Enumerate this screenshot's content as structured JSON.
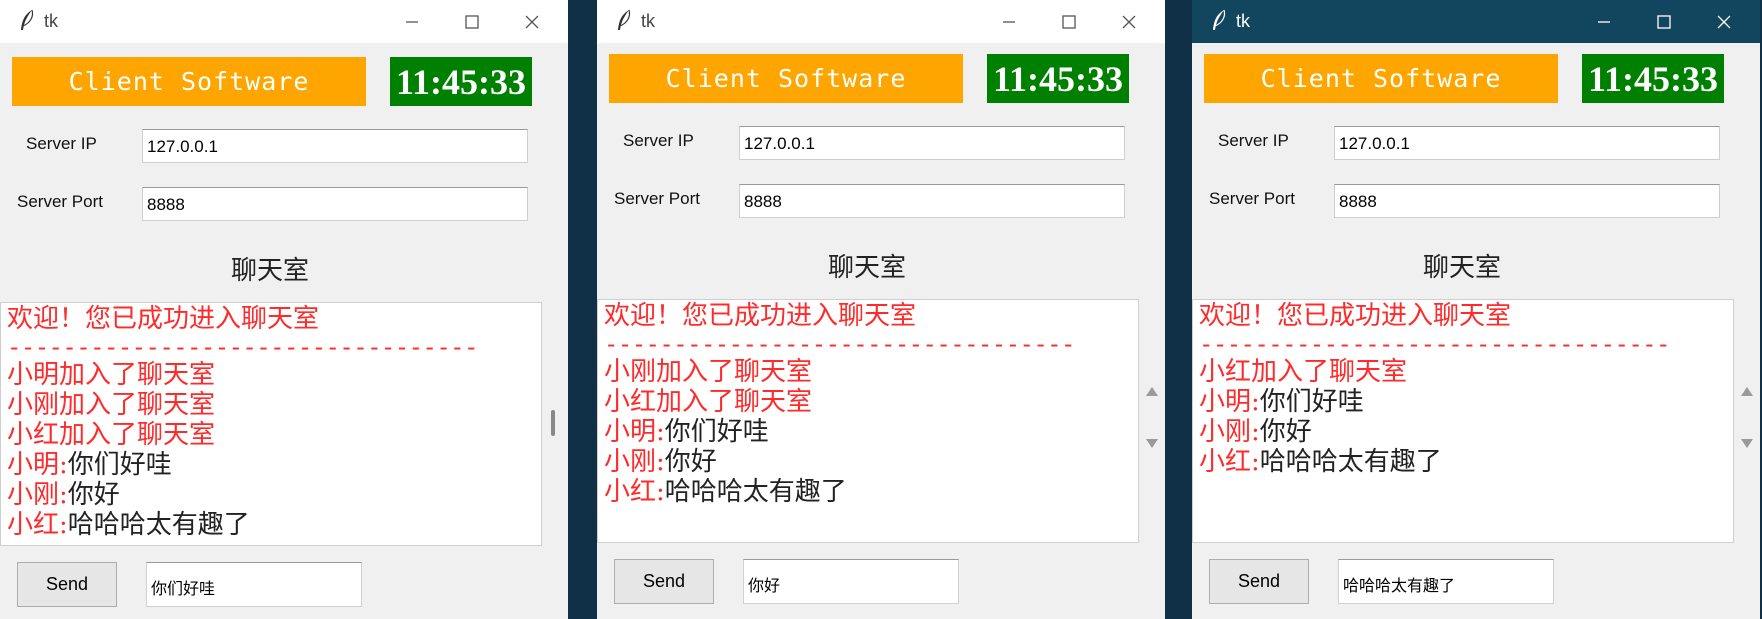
{
  "windows": [
    {
      "title": "tk",
      "banner": "Client Software",
      "clock": "11:45:33",
      "server_ip_label": "Server IP",
      "server_ip": "127.0.0.1",
      "server_port_label": "Server Port",
      "server_port": "8888",
      "room_title": "聊天室",
      "welcome": "欢迎！您已成功进入聊天室",
      "separator": "----------------------------------",
      "lines": [
        {
          "name": "小明加入了聊天室",
          "text": ""
        },
        {
          "name": "小刚加入了聊天室",
          "text": ""
        },
        {
          "name": "小红加入了聊天室",
          "text": ""
        },
        {
          "name": "小明:",
          "text": "你们好哇"
        },
        {
          "name": "小刚:",
          "text": "你好"
        },
        {
          "name": "小红:",
          "text": "哈哈哈太有趣了"
        }
      ],
      "send_label": "Send",
      "message": "你们好哇"
    },
    {
      "title": "tk",
      "banner": "Client Software",
      "clock": "11:45:33",
      "server_ip_label": "Server IP",
      "server_ip": "127.0.0.1",
      "server_port_label": "Server Port",
      "server_port": "8888",
      "room_title": "聊天室",
      "welcome": "欢迎！您已成功进入聊天室",
      "separator": "----------------------------------",
      "lines": [
        {
          "name": "小刚加入了聊天室",
          "text": ""
        },
        {
          "name": "小红加入了聊天室",
          "text": ""
        },
        {
          "name": "小明:",
          "text": "你们好哇"
        },
        {
          "name": "小刚:",
          "text": "你好"
        },
        {
          "name": "小红:",
          "text": "哈哈哈太有趣了"
        }
      ],
      "send_label": "Send",
      "message": "你好"
    },
    {
      "title": "tk",
      "banner": "Client Software",
      "clock": "11:45:33",
      "server_ip_label": "Server IP",
      "server_ip": "127.0.0.1",
      "server_port_label": "Server Port",
      "server_port": "8888",
      "room_title": "聊天室",
      "welcome": "欢迎！您已成功进入聊天室",
      "separator": "----------------------------------",
      "lines": [
        {
          "name": "小红加入了聊天室",
          "text": ""
        },
        {
          "name": "小明:",
          "text": "你们好哇"
        },
        {
          "name": "小刚:",
          "text": "你好"
        },
        {
          "name": "小红:",
          "text": "哈哈哈太有趣了"
        }
      ],
      "send_label": "Send",
      "message": "哈哈哈太有趣了"
    }
  ],
  "colors": {
    "banner": "#ffa500",
    "clock": "#008000",
    "chat_name": "#ff2a2a",
    "active_titlebar": "#12465f",
    "desktop": "#0f3047"
  },
  "icons": [
    "feather-icon",
    "minimize-icon",
    "maximize-icon",
    "close-icon"
  ]
}
